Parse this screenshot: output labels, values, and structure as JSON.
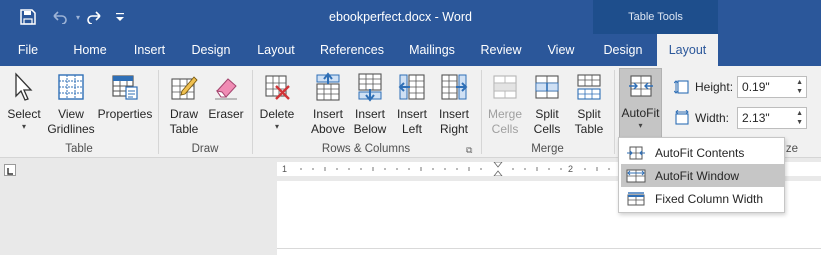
{
  "window": {
    "title": "ebookperfect.docx  -  Word",
    "context_group": "Table Tools"
  },
  "quick_access": {
    "save_icon": "save-icon",
    "undo_icon": "undo-icon",
    "redo_icon": "redo-icon",
    "customize_icon": "customize-qat-icon"
  },
  "tabs": [
    {
      "label": "File"
    },
    {
      "label": "Home"
    },
    {
      "label": "Insert"
    },
    {
      "label": "Design"
    },
    {
      "label": "Layout"
    },
    {
      "label": "References"
    },
    {
      "label": "Mailings"
    },
    {
      "label": "Review"
    },
    {
      "label": "View"
    },
    {
      "label": "Design"
    },
    {
      "label": "Layout"
    }
  ],
  "active_tab": "Layout",
  "ribbon": {
    "table": {
      "select": "Select",
      "view_gridlines_1": "View",
      "view_gridlines_2": "Gridlines",
      "properties": "Properties",
      "group": "Table"
    },
    "draw": {
      "draw_table_1": "Draw",
      "draw_table_2": "Table",
      "eraser": "Eraser",
      "group": "Draw"
    },
    "rows_columns": {
      "delete": "Delete",
      "insert_above_1": "Insert",
      "insert_above_2": "Above",
      "insert_below_1": "Insert",
      "insert_below_2": "Below",
      "insert_left_1": "Insert",
      "insert_left_2": "Left",
      "insert_right_1": "Insert",
      "insert_right_2": "Right",
      "group": "Rows & Columns"
    },
    "merge": {
      "merge_cells_1": "Merge",
      "merge_cells_2": "Cells",
      "split_cells_1": "Split",
      "split_cells_2": "Cells",
      "split_table_1": "Split",
      "split_table_2": "Table",
      "group": "Merge"
    },
    "autofit": {
      "label": "AutoFit"
    },
    "cell_size": {
      "height_label": "Height:",
      "height_value": "0.19\"",
      "width_label": "Width:",
      "width_value": "2.13\"",
      "group_partial": "ze"
    }
  },
  "autofit_menu": {
    "items": [
      {
        "label": "AutoFit Contents",
        "icon": "autofit-contents-icon"
      },
      {
        "label": "AutoFit Window",
        "icon": "autofit-window-icon"
      },
      {
        "label": "Fixed Column Width",
        "icon": "fixed-column-width-icon"
      }
    ],
    "highlighted": "AutoFit Window"
  },
  "ruler": {
    "marks": [
      "1",
      "1",
      "2"
    ]
  },
  "colors": {
    "brand": "#2b579a",
    "context": "#1e4e8c",
    "ribbon": "#f1f1f1",
    "accent_red": "#d13438",
    "icon_blue": "#2f6fb6"
  }
}
